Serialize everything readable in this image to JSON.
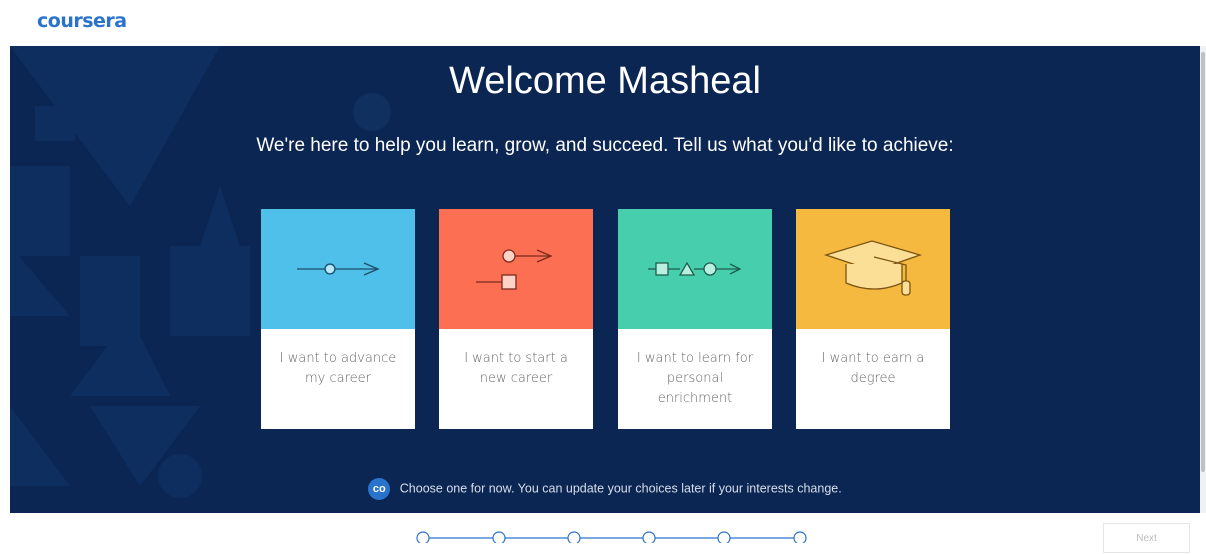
{
  "brand": {
    "logo_text": "coursera",
    "color": "#2a73cc"
  },
  "hero": {
    "title": "Welcome Masheal",
    "subtitle": "We're here to help you learn, grow, and succeed. Tell us what you'd like to achieve:",
    "background": "#0b2653"
  },
  "cards": [
    {
      "label": "I want to advance my career",
      "color": "#4ec0e9",
      "icon": "advance-arrow-icon"
    },
    {
      "label": "I want to start a new career",
      "color": "#fd6f53",
      "icon": "branch-arrow-icon"
    },
    {
      "label": "I want to learn for personal enrichment",
      "color": "#47cfad",
      "icon": "shapes-arrow-icon"
    },
    {
      "label": "I want to earn a degree",
      "color": "#f5b940",
      "icon": "graduation-cap-icon"
    }
  ],
  "hint": {
    "icon_text": "co",
    "text": "Choose one for now. You can update your choices later if your interests change."
  },
  "progress": {
    "steps": 6,
    "current": 1
  },
  "footer": {
    "next_label": "Next"
  }
}
